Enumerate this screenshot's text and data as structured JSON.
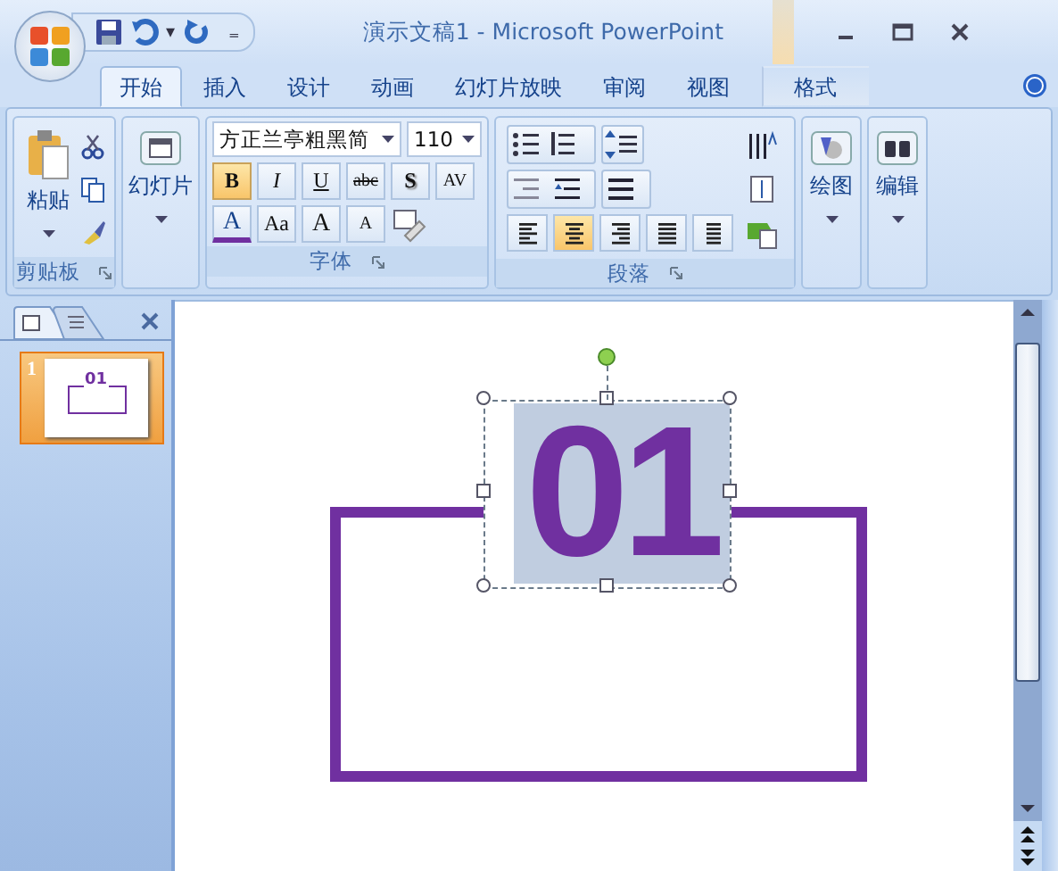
{
  "window": {
    "title": "演示文稿1 - Microsoft PowerPoint"
  },
  "quick_access": {
    "undo_arrow": "▾",
    "customize": "₌"
  },
  "tabs": [
    {
      "label": "开始",
      "selected": true,
      "kind": "standard"
    },
    {
      "label": "插入",
      "selected": false,
      "kind": "standard"
    },
    {
      "label": "设计",
      "selected": false,
      "kind": "standard"
    },
    {
      "label": "动画",
      "selected": false,
      "kind": "standard"
    },
    {
      "label": "幻灯片放映",
      "selected": false,
      "kind": "standard"
    },
    {
      "label": "审阅",
      "selected": false,
      "kind": "standard"
    },
    {
      "label": "视图",
      "selected": false,
      "kind": "standard"
    },
    {
      "label": "格式",
      "selected": false,
      "kind": "contextual"
    }
  ],
  "clipboard": {
    "paste": "粘贴",
    "label": "剪贴板"
  },
  "slides": {
    "label": "幻灯片"
  },
  "font": {
    "name": "方正兰亭粗黑简",
    "size": "110",
    "label": "字体",
    "styles": [
      {
        "label": "B",
        "selected": true,
        "kind": "bold"
      },
      {
        "label": "I",
        "selected": false,
        "kind": "italic"
      },
      {
        "label": "U",
        "selected": false,
        "kind": "underline"
      },
      {
        "label": "abc",
        "selected": false,
        "kind": "strike"
      },
      {
        "label": "S",
        "selected": false,
        "kind": "shadow"
      },
      {
        "label": "AV",
        "selected": false,
        "kind": "spacing"
      }
    ],
    "color_button": "A",
    "case_button": "Aa",
    "grow": "A",
    "shrink": "A"
  },
  "paragraph": {
    "label": "段落",
    "alignments": [
      {
        "kind": "left",
        "selected": false
      },
      {
        "kind": "center",
        "selected": true
      },
      {
        "kind": "right",
        "selected": false
      },
      {
        "kind": "justify",
        "selected": false
      },
      {
        "kind": "distributed",
        "selected": false
      }
    ]
  },
  "drawing": {
    "label": "绘图"
  },
  "editing": {
    "label": "编辑"
  },
  "thumbnails": [
    {
      "number": "1",
      "text": "01",
      "selected": true
    }
  ],
  "slide": {
    "text": "01"
  }
}
